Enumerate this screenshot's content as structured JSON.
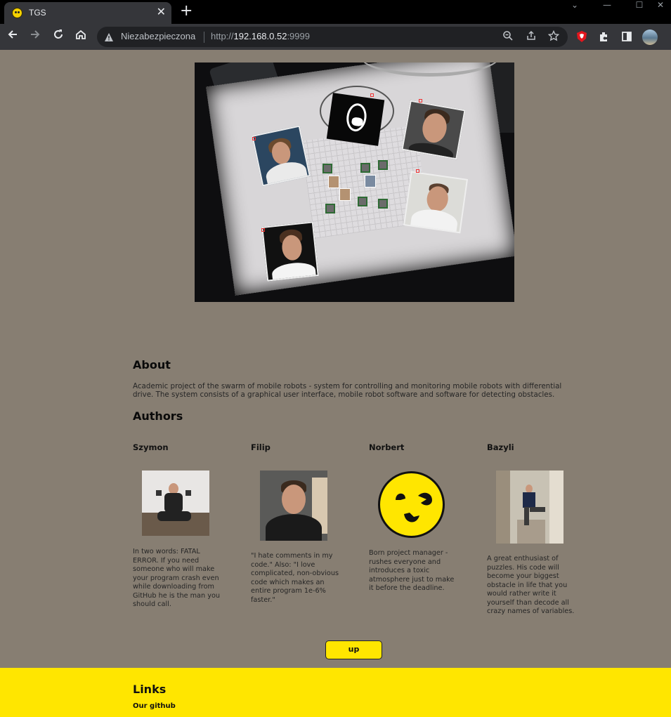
{
  "browser": {
    "tab_title": "TGS",
    "tab_close": "✕",
    "new_tab": "+",
    "security_label": "Niezabezpieczona",
    "url_scheme": "http://",
    "url_host": "192.168.0.52",
    "url_port": ":9999",
    "window_controls": [
      "⌄",
      "—",
      "☐",
      "✕"
    ]
  },
  "about": {
    "heading": "About",
    "text": "Academic project of the swarm of mobile robots - system for controlling and monitoring mobile robots with differential drive. The system consists of a graphical user interface, mobile robot software and software for detecting obstacles."
  },
  "authors": {
    "heading": "Authors",
    "list": [
      {
        "name": "Szymon",
        "desc": "In two words: FATAL ERROR. If you need someone who will make your program crash even while downloading from GitHub he is the man you should call."
      },
      {
        "name": "Filip",
        "desc": "\"I hate comments in my code.\" Also: \"I love complicated, non-obvious code which makes an entire program 1e-6% faster.\""
      },
      {
        "name": "Norbert",
        "desc": "Born project manager - rushes everyone and introduces a toxic atmosphere just to make it before the deadline."
      },
      {
        "name": "Bazyli",
        "desc": "A great enthusiast of puzzles. His code will become your biggest obstacle in life that you would rather write it yourself than decode all crazy names of variables."
      }
    ]
  },
  "up_button": "up",
  "footer": {
    "heading": "Links",
    "github_link": "Our github"
  },
  "colors": {
    "page_bg": "#877e72",
    "accent_yellow": "#ffe600"
  }
}
